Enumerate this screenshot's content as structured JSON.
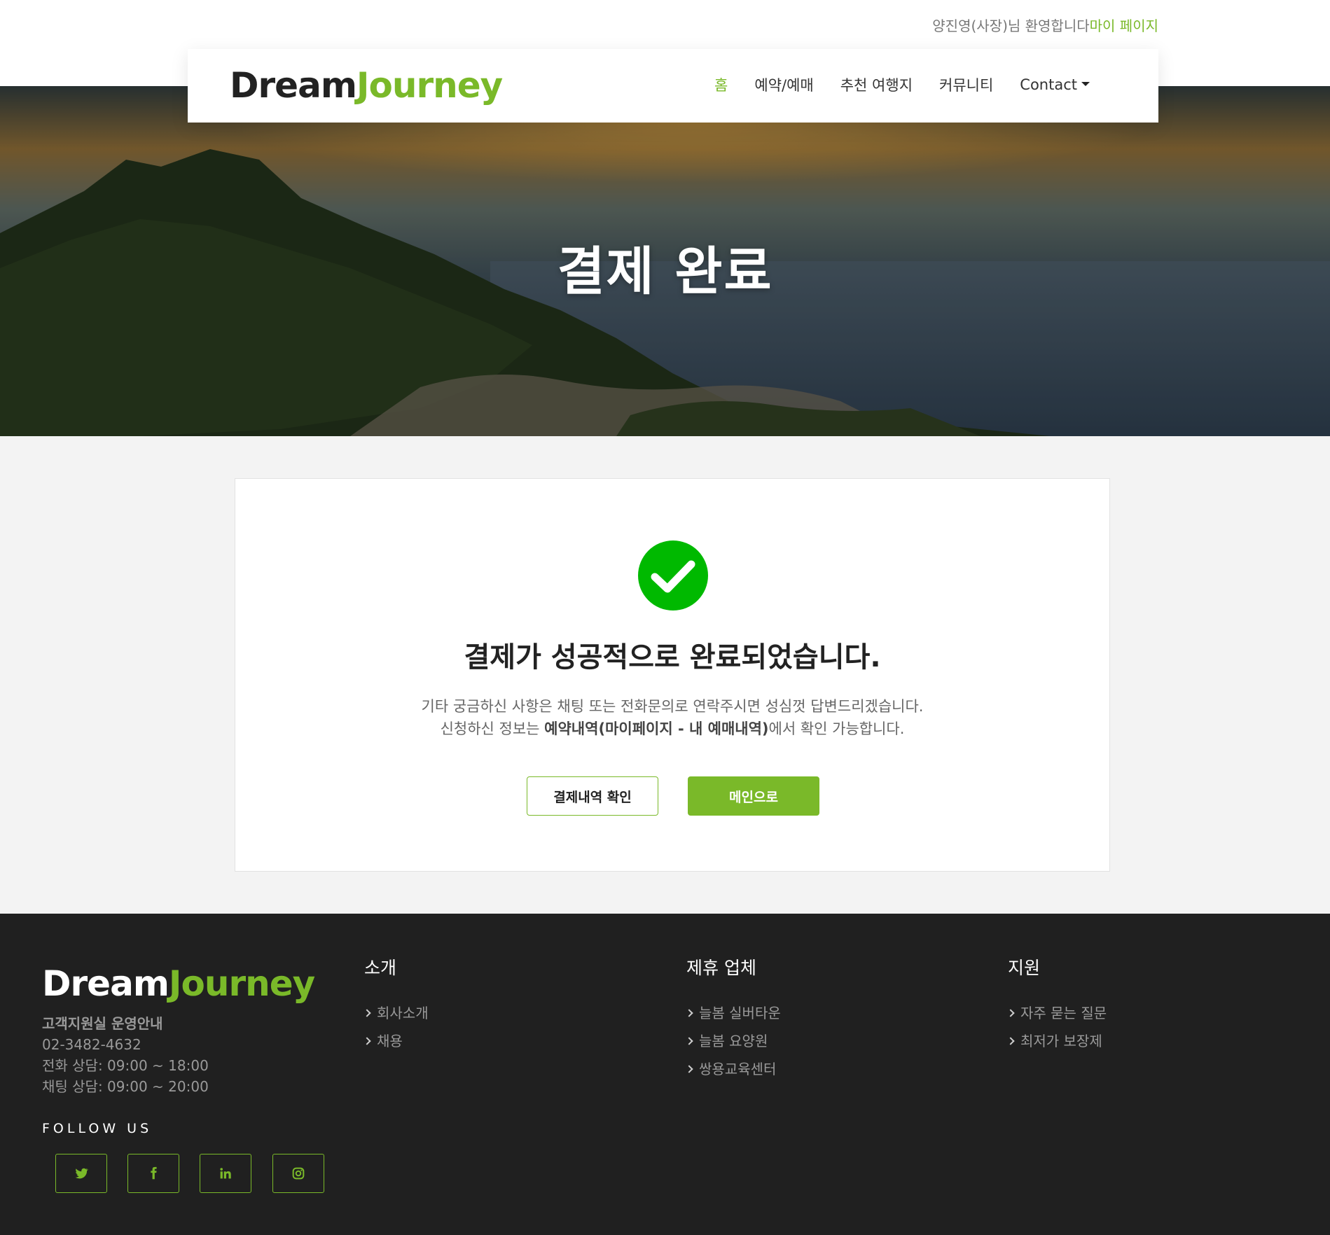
{
  "header": {
    "welcome_text": "양진영(사장)님 환영합니다",
    "mypage_link": "마이 페이지"
  },
  "brand": {
    "part1": "Dream",
    "part2": "Journey"
  },
  "nav": {
    "items": [
      {
        "label": "홈",
        "active": true
      },
      {
        "label": "예약/예매",
        "active": false
      },
      {
        "label": "추천 여행지",
        "active": false
      },
      {
        "label": "커뮤니티",
        "active": false
      },
      {
        "label": "Contact",
        "active": false,
        "dropdown": true
      }
    ]
  },
  "hero": {
    "title": "결제 완료"
  },
  "result": {
    "icon": "check-circle-icon",
    "headline": "결제가 성공적으로 완료되었습니다.",
    "line1": "기타 궁금하신 사항은 채팅 또는 전화문의로 연락주시면 성심껏 답변드리겠습니다.",
    "line2_prefix": "신청하신 정보는 ",
    "line2_bold": "예약내역(마이페이지 - 내 예매내역)",
    "line2_suffix": "에서 확인 가능합니다.",
    "btn_history": "결제내역 확인",
    "btn_main": "메인으로"
  },
  "footer": {
    "brand": {
      "part1": "Dream",
      "part2": "Journey"
    },
    "support_title": "고객지원실 운영안내",
    "phone": "02-3482-4632",
    "phone_hours": "전화 상담: 09:00 ~ 18:00",
    "chat_hours": "채팅 상담: 09:00 ~ 20:00",
    "follow_label": "FOLLOW US",
    "socials": [
      "twitter-icon",
      "facebook-icon",
      "linkedin-icon",
      "instagram-icon"
    ],
    "columns": [
      {
        "title": "소개",
        "links": [
          "회사소개",
          "채용"
        ]
      },
      {
        "title": "제휴 업체",
        "links": [
          "늘봄 실버타운",
          "늘봄 요양원",
          "쌍용교육센터"
        ]
      },
      {
        "title": "지원",
        "links": [
          "자주 묻는 질문",
          "최저가 보장제"
        ]
      }
    ]
  },
  "colors": {
    "accent": "#7ab929",
    "success": "#00b900",
    "footer_bg": "#202020"
  }
}
